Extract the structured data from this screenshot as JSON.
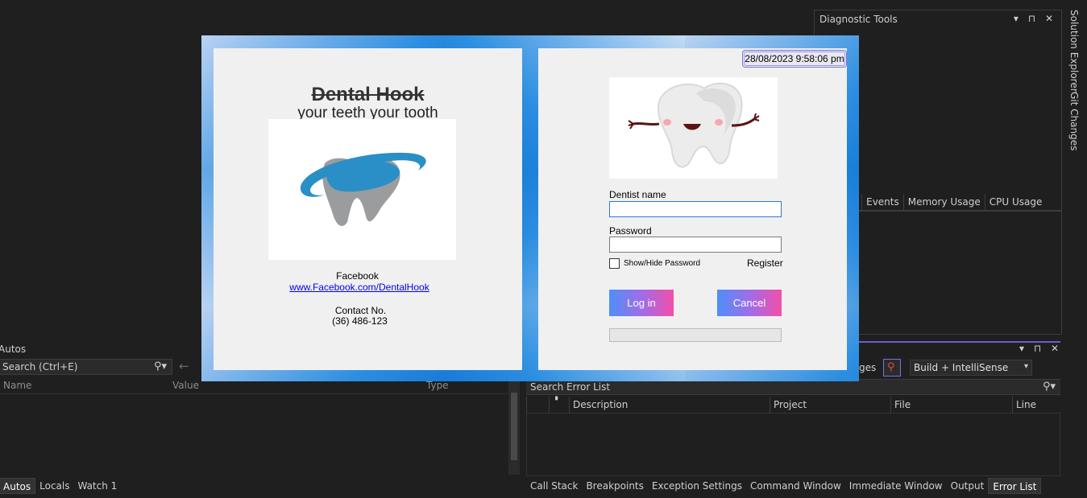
{
  "ide": {
    "diagnostic_tools": {
      "title": "Diagnostic Tools",
      "controls": "▾ ⊓ ✕",
      "tabs": [
        "y",
        "Events",
        "Memory Usage",
        "CPU Usage"
      ]
    },
    "vertical_tabs": [
      "Solution Explorer",
      "Git Changes"
    ],
    "autos": {
      "title": "Autos",
      "search_placeholder": "Search (Ctrl+E)",
      "columns": [
        "Name",
        "Value",
        "Type"
      ],
      "tabs": [
        "Autos",
        "Locals",
        "Watch 1"
      ]
    },
    "error_list": {
      "controls": "▾ ⊓ ✕",
      "partial_label": "ges",
      "build_filter": "Build + IntelliSense",
      "search_placeholder": "Search Error List",
      "columns": [
        "Description",
        "Project",
        "File",
        "Line"
      ],
      "tabs": [
        "Call Stack",
        "Breakpoints",
        "Exception Settings",
        "Command Window",
        "Immediate Window",
        "Output",
        "Error List"
      ]
    }
  },
  "login_form": {
    "brand_name": "Dental Hook",
    "tagline": "your teeth your tooth",
    "facebook_label": "Facebook",
    "facebook_link": "www.Facebook.com/DentalHook",
    "contact_label": "Contact No.",
    "contact_number": "(36) 486-123",
    "datetime": "28/08/2023 9:58:06 pm",
    "dentist_name_label": "Dentist name",
    "dentist_name_value": "",
    "password_label": "Password",
    "password_value": "",
    "show_hide_label": "Show/Hide Password",
    "register_label": "Register",
    "login_button": "Log in",
    "cancel_button": "Cancel",
    "progress": 0
  },
  "colors": {
    "ide_bg": "#1f1f1f",
    "form_panel": "#f0f0f0",
    "logo_blue": "#2a8fc6",
    "logo_gray": "#9a9c9e",
    "button_gradient_start": "#4f8ff7",
    "button_gradient_end": "#f34fa8",
    "link": "#0000ee"
  }
}
